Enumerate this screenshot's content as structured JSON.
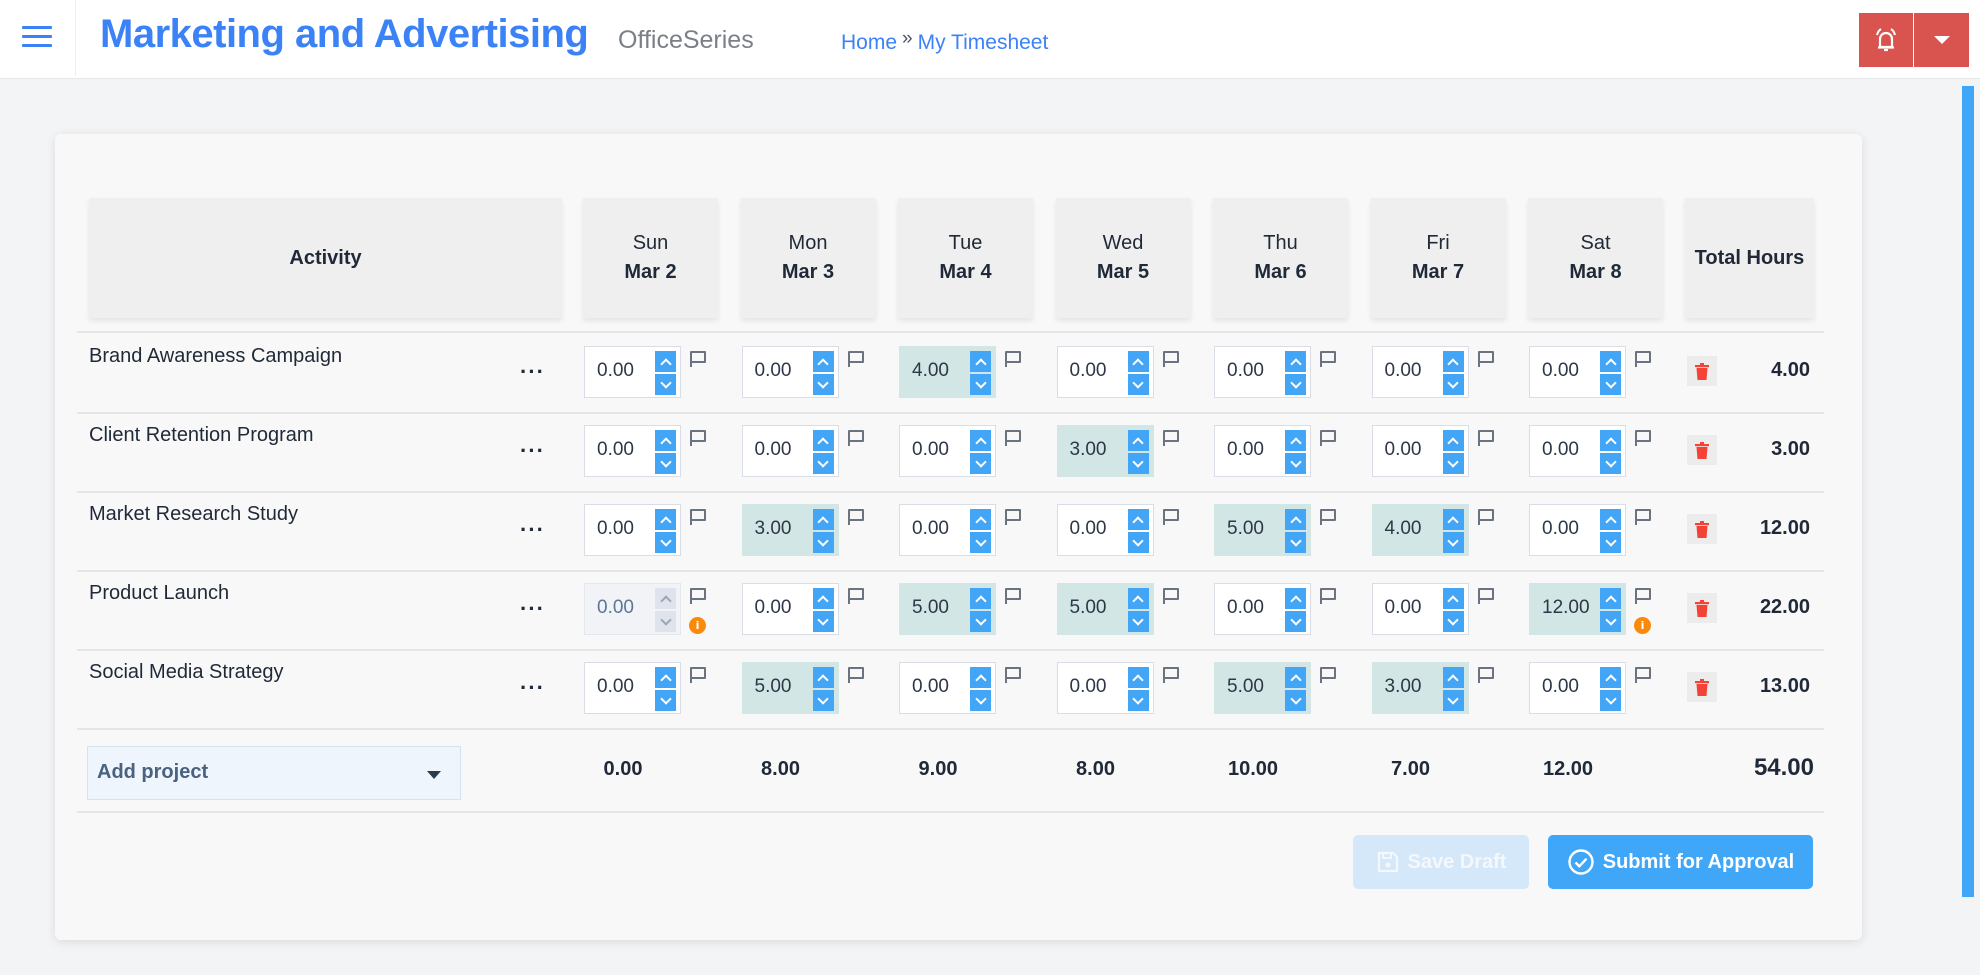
{
  "header": {
    "title": "Marketing and Advertising",
    "subtitle": "OfficeSeries",
    "breadcrumb": {
      "home": "Home",
      "separator": "»",
      "current": "My Timesheet"
    },
    "menu_icon": "hamburger-icon",
    "alert_icon": "bell-ringing-icon",
    "dropdown_icon": "caret-down-icon",
    "accent_color": "#3b82f6",
    "alert_color": "#d9534f"
  },
  "table": {
    "activity_header": "Activity",
    "total_header": "Total Hours",
    "days": [
      {
        "day": "Sun",
        "date": "Mar 2"
      },
      {
        "day": "Mon",
        "date": "Mar 3"
      },
      {
        "day": "Tue",
        "date": "Mar 4"
      },
      {
        "day": "Wed",
        "date": "Mar 5"
      },
      {
        "day": "Thu",
        "date": "Mar 6"
      },
      {
        "day": "Fri",
        "date": "Mar 7"
      },
      {
        "day": "Sat",
        "date": "Mar 8"
      }
    ],
    "rows": [
      {
        "activity": "Brand Awareness Campaign",
        "more": "···",
        "hours": [
          "0.00",
          "0.00",
          "4.00",
          "0.00",
          "0.00",
          "0.00",
          "0.00"
        ],
        "filled": [
          false,
          false,
          true,
          false,
          false,
          false,
          false
        ],
        "disabled": [
          false,
          false,
          false,
          false,
          false,
          false,
          false
        ],
        "info": [
          false,
          false,
          false,
          false,
          false,
          false,
          false
        ],
        "total": "4.00"
      },
      {
        "activity": "Client Retention Program",
        "more": "···",
        "hours": [
          "0.00",
          "0.00",
          "0.00",
          "3.00",
          "0.00",
          "0.00",
          "0.00"
        ],
        "filled": [
          false,
          false,
          false,
          true,
          false,
          false,
          false
        ],
        "disabled": [
          false,
          false,
          false,
          false,
          false,
          false,
          false
        ],
        "info": [
          false,
          false,
          false,
          false,
          false,
          false,
          false
        ],
        "total": "3.00"
      },
      {
        "activity": "Market Research Study",
        "more": "···",
        "hours": [
          "0.00",
          "3.00",
          "0.00",
          "0.00",
          "5.00",
          "4.00",
          "0.00"
        ],
        "filled": [
          false,
          true,
          false,
          false,
          true,
          true,
          false
        ],
        "disabled": [
          false,
          false,
          false,
          false,
          false,
          false,
          false
        ],
        "info": [
          false,
          false,
          false,
          false,
          false,
          false,
          false
        ],
        "total": "12.00"
      },
      {
        "activity": "Product Launch",
        "more": "···",
        "hours": [
          "0.00",
          "0.00",
          "5.00",
          "5.00",
          "0.00",
          "0.00",
          "12.00"
        ],
        "filled": [
          false,
          false,
          true,
          true,
          false,
          false,
          true
        ],
        "disabled": [
          true,
          false,
          false,
          false,
          false,
          false,
          false
        ],
        "info": [
          true,
          false,
          false,
          false,
          false,
          false,
          true
        ],
        "total": "22.00"
      },
      {
        "activity": "Social Media Strategy",
        "more": "···",
        "hours": [
          "0.00",
          "5.00",
          "0.00",
          "0.00",
          "5.00",
          "3.00",
          "0.00"
        ],
        "filled": [
          false,
          true,
          false,
          false,
          true,
          true,
          false
        ],
        "disabled": [
          false,
          false,
          false,
          false,
          false,
          false,
          false
        ],
        "info": [
          false,
          false,
          false,
          false,
          false,
          false,
          false
        ],
        "total": "13.00"
      }
    ],
    "day_totals": [
      "0.00",
      "8.00",
      "9.00",
      "8.00",
      "10.00",
      "7.00",
      "12.00"
    ],
    "grand_total": "54.00",
    "info_badge": "i"
  },
  "footer": {
    "add_project_label": "Add project",
    "save_draft_label": "Save Draft",
    "submit_label": "Submit for Approval"
  },
  "colors": {
    "spinner": "#42a5f5",
    "filled_cell": "#d2e6e5",
    "delete": "#f44336",
    "info": "#f98a0c",
    "submit": "#3fa6f8"
  }
}
